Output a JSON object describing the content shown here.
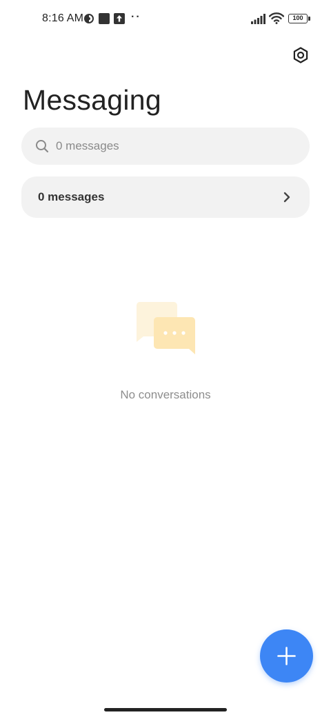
{
  "status_bar": {
    "time": "8:16 AM",
    "overflow_dots": "··",
    "battery_level": "100",
    "icons": [
      "vpn-icon",
      "square-notification-icon",
      "upload-icon",
      "signal-icon",
      "wifi-icon",
      "battery-icon"
    ]
  },
  "header": {
    "title": "Messaging",
    "settings_icon": "settings-hex-icon"
  },
  "search": {
    "placeholder": "0 messages",
    "value": ""
  },
  "messages_row": {
    "label": "0 messages",
    "icon": "chevron-right-icon"
  },
  "empty_state": {
    "illustration": "chat-bubbles-icon",
    "text": "No conversations"
  },
  "fab": {
    "icon": "plus-icon",
    "color": "#3d86f5"
  },
  "colors": {
    "accent": "#3d86f5",
    "surface": "#f2f2f2",
    "illustration_light": "#fdf3dc",
    "illustration_main": "#fde6b3"
  }
}
